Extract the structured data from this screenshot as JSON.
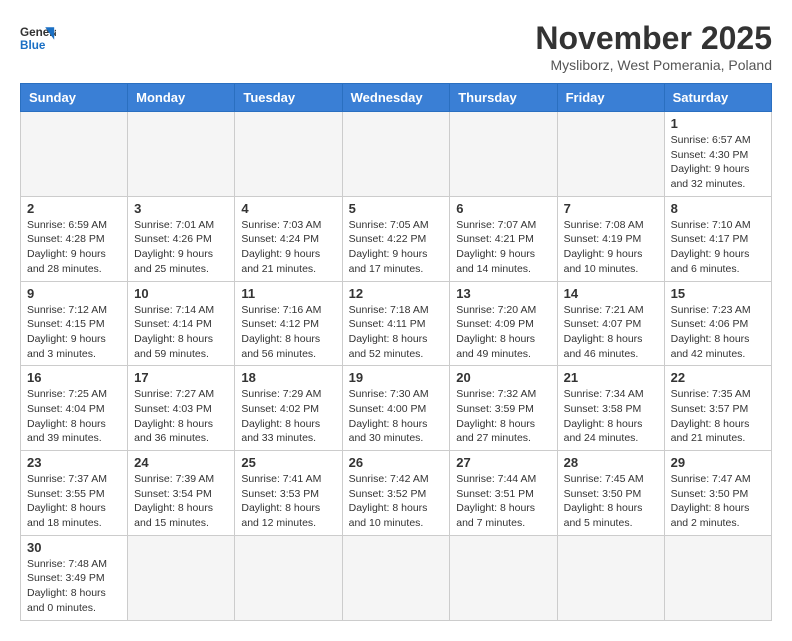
{
  "logo": {
    "general": "General",
    "blue": "Blue"
  },
  "title": "November 2025",
  "subtitle": "Mysliborz, West Pomerania, Poland",
  "weekdays": [
    "Sunday",
    "Monday",
    "Tuesday",
    "Wednesday",
    "Thursday",
    "Friday",
    "Saturday"
  ],
  "weeks": [
    [
      {
        "day": "",
        "info": ""
      },
      {
        "day": "",
        "info": ""
      },
      {
        "day": "",
        "info": ""
      },
      {
        "day": "",
        "info": ""
      },
      {
        "day": "",
        "info": ""
      },
      {
        "day": "",
        "info": ""
      },
      {
        "day": "1",
        "info": "Sunrise: 6:57 AM\nSunset: 4:30 PM\nDaylight: 9 hours\nand 32 minutes."
      }
    ],
    [
      {
        "day": "2",
        "info": "Sunrise: 6:59 AM\nSunset: 4:28 PM\nDaylight: 9 hours\nand 28 minutes."
      },
      {
        "day": "3",
        "info": "Sunrise: 7:01 AM\nSunset: 4:26 PM\nDaylight: 9 hours\nand 25 minutes."
      },
      {
        "day": "4",
        "info": "Sunrise: 7:03 AM\nSunset: 4:24 PM\nDaylight: 9 hours\nand 21 minutes."
      },
      {
        "day": "5",
        "info": "Sunrise: 7:05 AM\nSunset: 4:22 PM\nDaylight: 9 hours\nand 17 minutes."
      },
      {
        "day": "6",
        "info": "Sunrise: 7:07 AM\nSunset: 4:21 PM\nDaylight: 9 hours\nand 14 minutes."
      },
      {
        "day": "7",
        "info": "Sunrise: 7:08 AM\nSunset: 4:19 PM\nDaylight: 9 hours\nand 10 minutes."
      },
      {
        "day": "8",
        "info": "Sunrise: 7:10 AM\nSunset: 4:17 PM\nDaylight: 9 hours\nand 6 minutes."
      }
    ],
    [
      {
        "day": "9",
        "info": "Sunrise: 7:12 AM\nSunset: 4:15 PM\nDaylight: 9 hours\nand 3 minutes."
      },
      {
        "day": "10",
        "info": "Sunrise: 7:14 AM\nSunset: 4:14 PM\nDaylight: 8 hours\nand 59 minutes."
      },
      {
        "day": "11",
        "info": "Sunrise: 7:16 AM\nSunset: 4:12 PM\nDaylight: 8 hours\nand 56 minutes."
      },
      {
        "day": "12",
        "info": "Sunrise: 7:18 AM\nSunset: 4:11 PM\nDaylight: 8 hours\nand 52 minutes."
      },
      {
        "day": "13",
        "info": "Sunrise: 7:20 AM\nSunset: 4:09 PM\nDaylight: 8 hours\nand 49 minutes."
      },
      {
        "day": "14",
        "info": "Sunrise: 7:21 AM\nSunset: 4:07 PM\nDaylight: 8 hours\nand 46 minutes."
      },
      {
        "day": "15",
        "info": "Sunrise: 7:23 AM\nSunset: 4:06 PM\nDaylight: 8 hours\nand 42 minutes."
      }
    ],
    [
      {
        "day": "16",
        "info": "Sunrise: 7:25 AM\nSunset: 4:04 PM\nDaylight: 8 hours\nand 39 minutes."
      },
      {
        "day": "17",
        "info": "Sunrise: 7:27 AM\nSunset: 4:03 PM\nDaylight: 8 hours\nand 36 minutes."
      },
      {
        "day": "18",
        "info": "Sunrise: 7:29 AM\nSunset: 4:02 PM\nDaylight: 8 hours\nand 33 minutes."
      },
      {
        "day": "19",
        "info": "Sunrise: 7:30 AM\nSunset: 4:00 PM\nDaylight: 8 hours\nand 30 minutes."
      },
      {
        "day": "20",
        "info": "Sunrise: 7:32 AM\nSunset: 3:59 PM\nDaylight: 8 hours\nand 27 minutes."
      },
      {
        "day": "21",
        "info": "Sunrise: 7:34 AM\nSunset: 3:58 PM\nDaylight: 8 hours\nand 24 minutes."
      },
      {
        "day": "22",
        "info": "Sunrise: 7:35 AM\nSunset: 3:57 PM\nDaylight: 8 hours\nand 21 minutes."
      }
    ],
    [
      {
        "day": "23",
        "info": "Sunrise: 7:37 AM\nSunset: 3:55 PM\nDaylight: 8 hours\nand 18 minutes."
      },
      {
        "day": "24",
        "info": "Sunrise: 7:39 AM\nSunset: 3:54 PM\nDaylight: 8 hours\nand 15 minutes."
      },
      {
        "day": "25",
        "info": "Sunrise: 7:41 AM\nSunset: 3:53 PM\nDaylight: 8 hours\nand 12 minutes."
      },
      {
        "day": "26",
        "info": "Sunrise: 7:42 AM\nSunset: 3:52 PM\nDaylight: 8 hours\nand 10 minutes."
      },
      {
        "day": "27",
        "info": "Sunrise: 7:44 AM\nSunset: 3:51 PM\nDaylight: 8 hours\nand 7 minutes."
      },
      {
        "day": "28",
        "info": "Sunrise: 7:45 AM\nSunset: 3:50 PM\nDaylight: 8 hours\nand 5 minutes."
      },
      {
        "day": "29",
        "info": "Sunrise: 7:47 AM\nSunset: 3:50 PM\nDaylight: 8 hours\nand 2 minutes."
      }
    ],
    [
      {
        "day": "30",
        "info": "Sunrise: 7:48 AM\nSunset: 3:49 PM\nDaylight: 8 hours\nand 0 minutes."
      },
      {
        "day": "",
        "info": ""
      },
      {
        "day": "",
        "info": ""
      },
      {
        "day": "",
        "info": ""
      },
      {
        "day": "",
        "info": ""
      },
      {
        "day": "",
        "info": ""
      },
      {
        "day": "",
        "info": ""
      }
    ]
  ]
}
